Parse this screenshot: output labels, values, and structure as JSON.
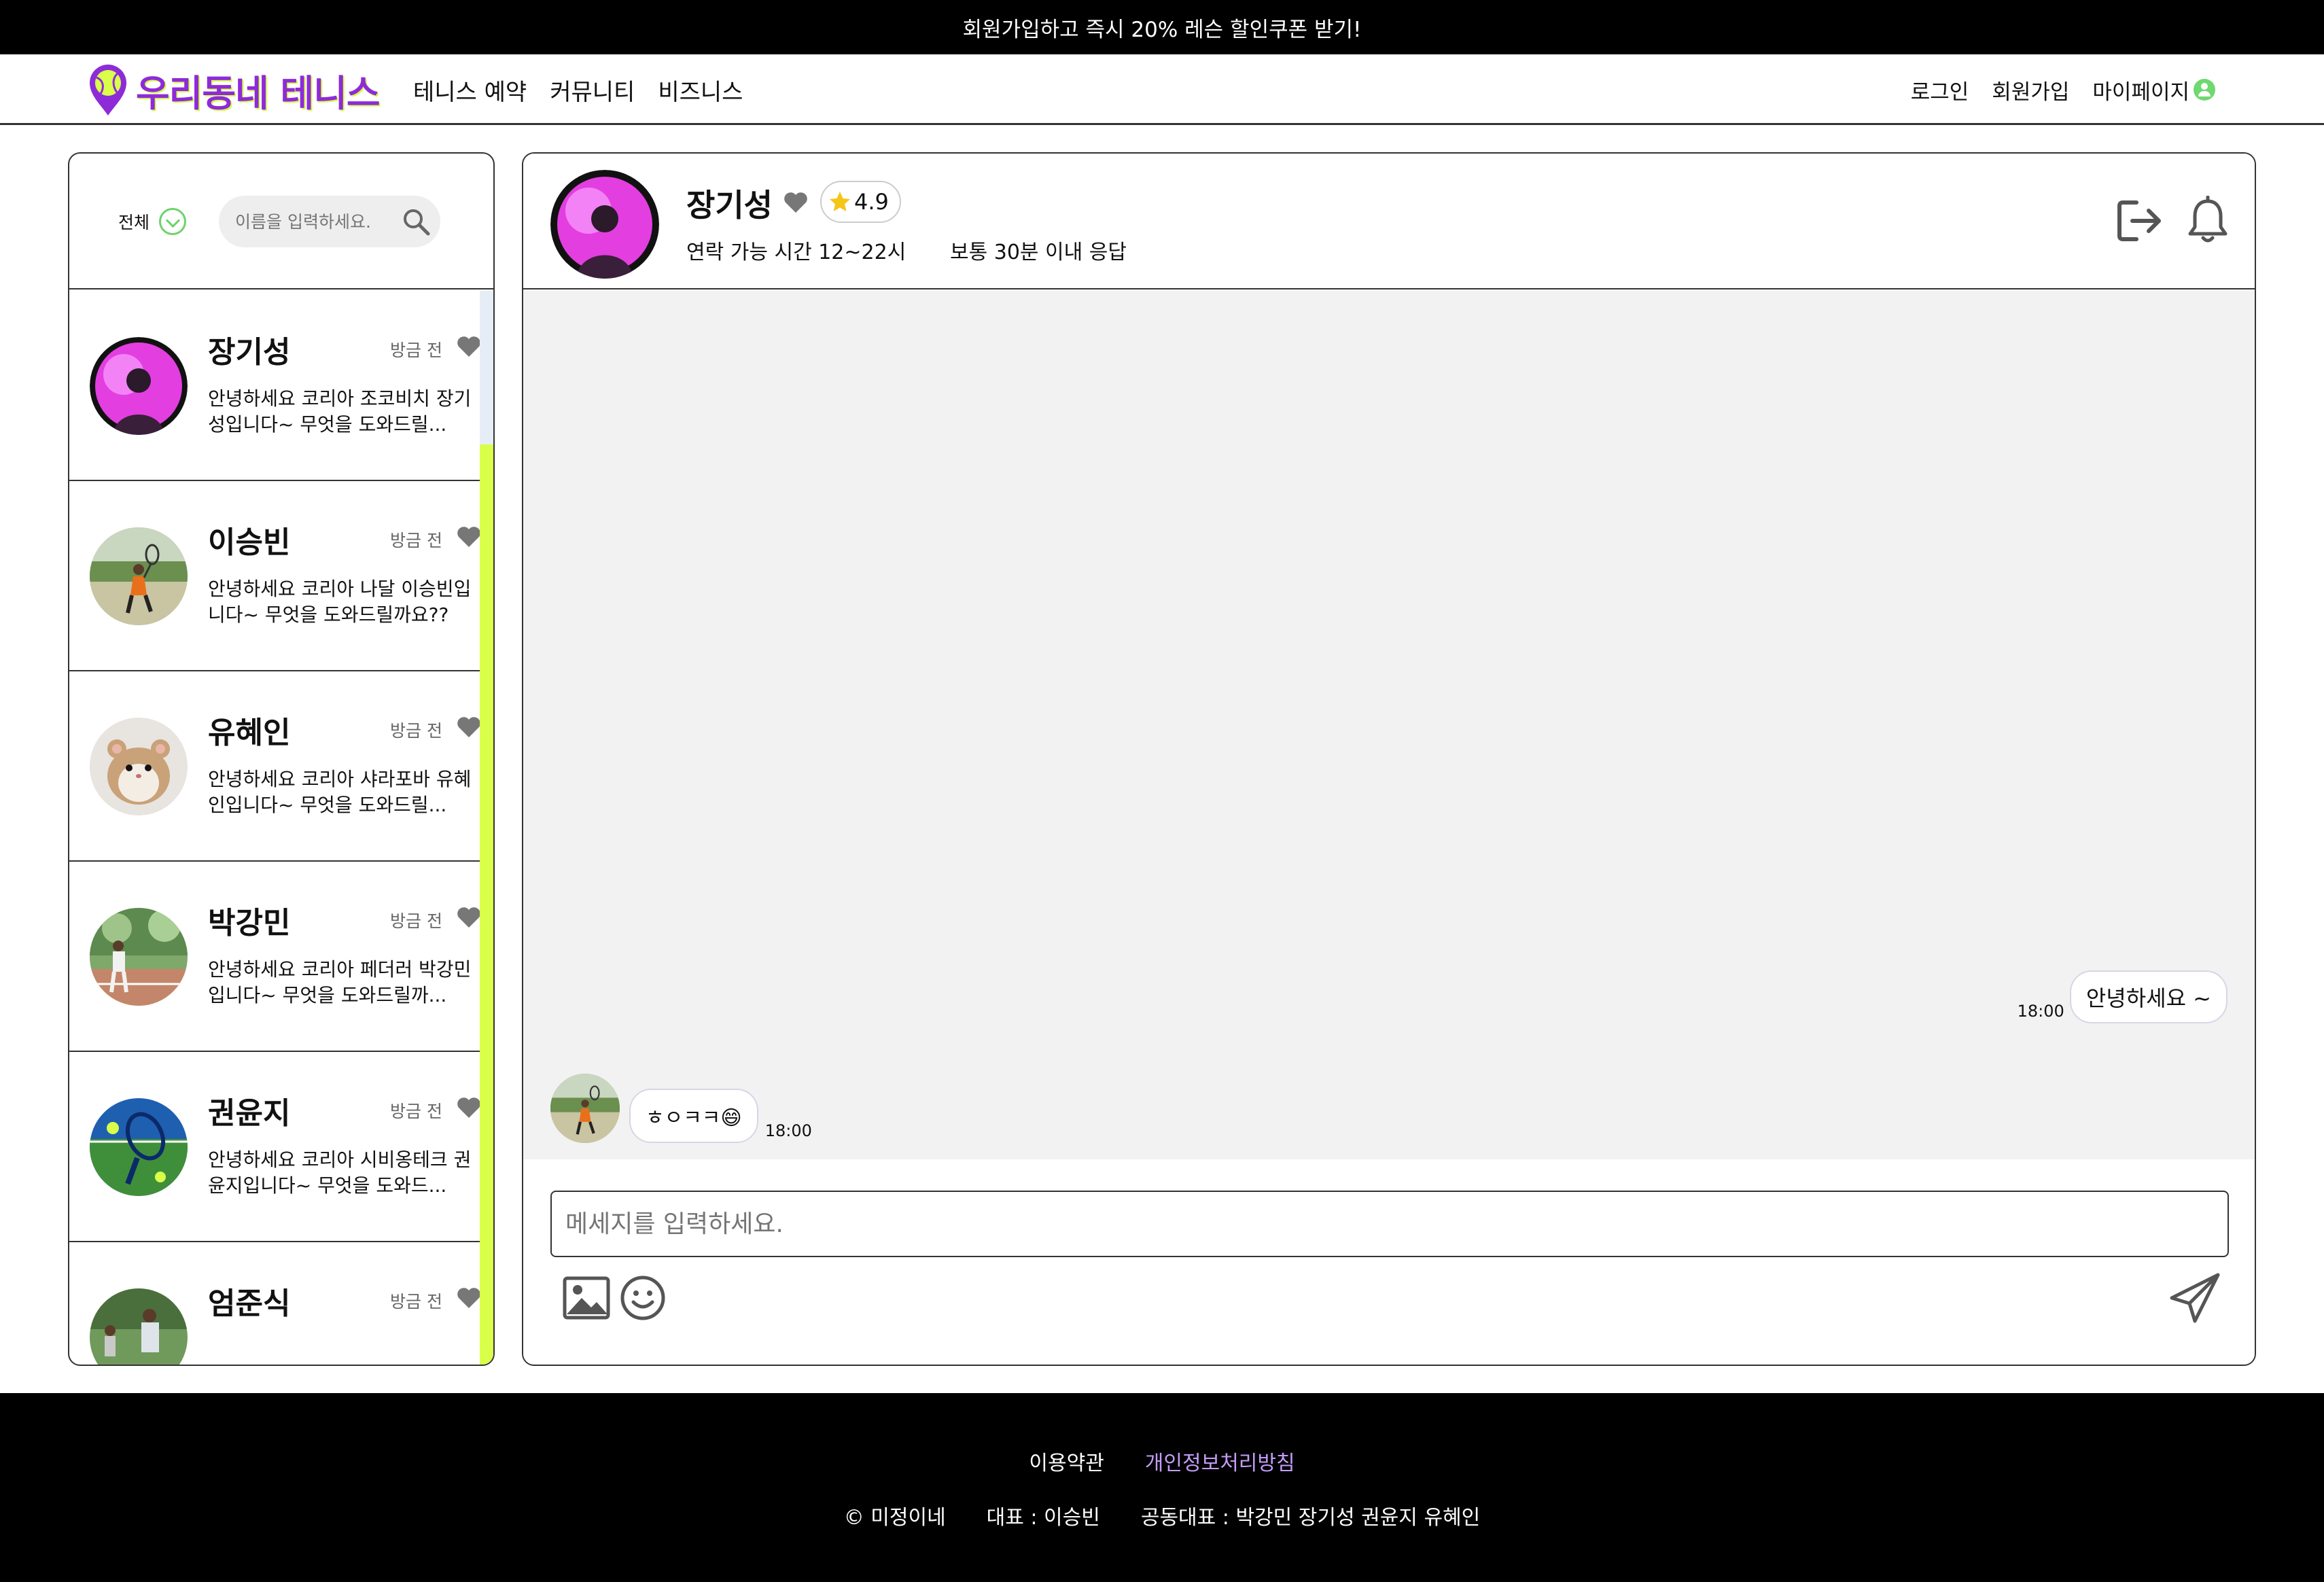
{
  "banner": {
    "text": "회원가입하고 즉시 20% 레슨 할인쿠폰 받기!"
  },
  "header": {
    "logo_text": "우리동네 테니스",
    "nav": [
      "테니스 예약",
      "커뮤니티",
      "비즈니스"
    ],
    "auth": {
      "login": "로그인",
      "signup": "회원가입",
      "mypage": "마이페이지"
    }
  },
  "sidebar": {
    "filter_label": "전체",
    "search_placeholder": "이름을 입력하세요.",
    "chats": [
      {
        "name": "장기성",
        "time": "방금 전",
        "preview": "안녕하세요 코리아 조코비치 장기성입니다~ 무엇을 도와드릴..."
      },
      {
        "name": "이승빈",
        "time": "방금 전",
        "preview": "안녕하세요 코리아 나달 이승빈입니다~ 무엇을 도와드릴까요??"
      },
      {
        "name": "유혜인",
        "time": "방금 전",
        "preview": "안녕하세요 코리아 샤라포바 유혜인입니다~ 무엇을 도와드릴..."
      },
      {
        "name": "박강민",
        "time": "방금 전",
        "preview": "안녕하세요 코리아 페더러 박강민입니다~ 무엇을 도와드릴까..."
      },
      {
        "name": "권윤지",
        "time": "방금 전",
        "preview": "안녕하세요 코리아 시비옹테크 권윤지입니다~ 무엇을 도와드..."
      },
      {
        "name": "엄준식",
        "time": "방금 전",
        "preview": ""
      }
    ]
  },
  "conversation": {
    "name": "장기성",
    "rating": "4.9",
    "availability": "연락 가능 시간 12~22시",
    "response": "보통 30분 이내 응답",
    "messages": {
      "outgoing": {
        "text": "안녕하세요 ~",
        "time": "18:00"
      },
      "incoming": {
        "text": "ㅎㅇㅋㅋ😄",
        "time": "18:00"
      }
    },
    "input_placeholder": "메세지를 입력하세요."
  },
  "footer": {
    "terms": "이용약관",
    "privacy": "개인정보처리방침",
    "copyright": "© 미정이네",
    "ceo": "대표 : 이승빈",
    "co_ceo": "공동대표 : 박강민 장기성 권윤지 유혜인"
  },
  "colors": {
    "brand": "#8e2bd8",
    "accent_lime": "#d9ff4a",
    "check_green": "#6dd36d",
    "privacy_link": "#c39cf7"
  }
}
